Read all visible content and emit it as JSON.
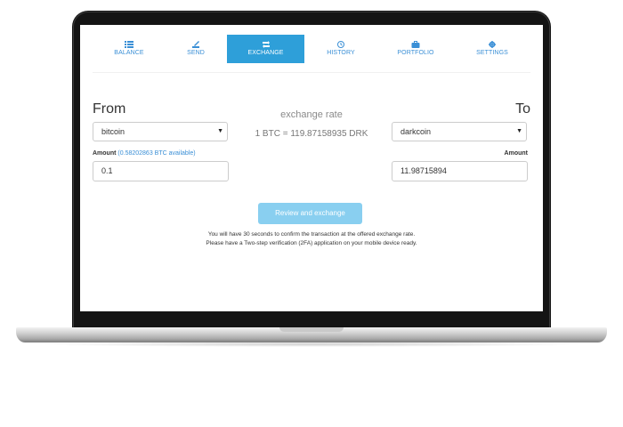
{
  "nav": {
    "items": [
      {
        "label": "BALANCE",
        "icon": "list-icon"
      },
      {
        "label": "SEND",
        "icon": "send-icon"
      },
      {
        "label": "EXCHANGE",
        "icon": "exchange-icon"
      },
      {
        "label": "HISTORY",
        "icon": "clock-icon"
      },
      {
        "label": "PORTFOLIO",
        "icon": "briefcase-icon"
      },
      {
        "label": "SETTINGS",
        "icon": "gear-icon"
      }
    ],
    "active": "EXCHANGE"
  },
  "exchange": {
    "from_label": "From",
    "to_label": "To",
    "rate_title": "exchange rate",
    "rate_value": "1 BTC = 119.87158935 DRK",
    "from_currency": "bitcoin",
    "to_currency": "darkcoin",
    "amount_label": "Amount",
    "available": "(0.58202863 BTC available)",
    "from_amount": "0.1",
    "to_amount_label": "Amount",
    "to_amount": "11.98715894",
    "submit_label": "Review and exchange",
    "note_line1": "You will have 30 seconds to confirm the transaction at the offered exchange rate.",
    "note_line2": "Please have a Two-step verification (2FA) application on your mobile device ready."
  },
  "colors": {
    "accent": "#2e9fd9",
    "link": "#3a8fd6",
    "button": "#89cff0"
  }
}
